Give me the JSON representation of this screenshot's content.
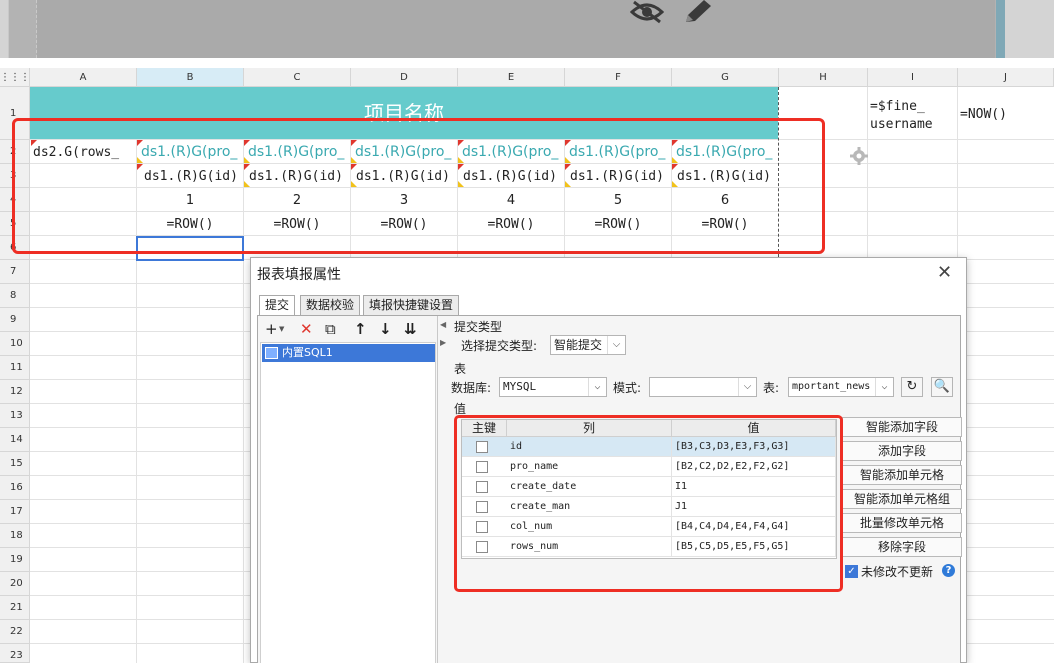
{
  "preview": {
    "icons": [
      "eye-off-icon",
      "pencil-icon"
    ]
  },
  "grid": {
    "corner": "⋮⋮⋮",
    "columns": [
      "A",
      "B",
      "C",
      "D",
      "E",
      "F",
      "G",
      "H",
      "I",
      "J"
    ],
    "selected_column": "B",
    "rows": [
      "1",
      "2",
      "3",
      "4",
      "5",
      "6",
      "7",
      "8",
      "9",
      "10",
      "11",
      "12",
      "13",
      "14",
      "15",
      "16",
      "17",
      "18",
      "19",
      "20",
      "21",
      "22",
      "23"
    ],
    "title_cell": "项目名称",
    "row1": {
      "I": "=$fine_\nusername",
      "J": "=NOW()"
    },
    "row2": {
      "A": "ds2.G(rows_",
      "B": "ds1.(R)G(pro_",
      "C": "ds1.(R)G(pro_",
      "D": "ds1.(R)G(pro_",
      "E": "ds1.(R)G(pro_",
      "F": "ds1.(R)G(pro_",
      "G": "ds1.(R)G(pro_"
    },
    "row3": [
      "ds1.(R)G(id)",
      "ds1.(R)G(id)",
      "ds1.(R)G(id)",
      "ds1.(R)G(id)",
      "ds1.(R)G(id)",
      "ds1.(R)G(id)"
    ],
    "row4": [
      "1",
      "2",
      "3",
      "4",
      "5",
      "6"
    ],
    "row5": [
      "=ROW()",
      "=ROW()",
      "=ROW()",
      "=ROW()",
      "=ROW()",
      "=ROW()"
    ],
    "gear_icon": "gear-icon"
  },
  "dialog": {
    "title": "报表填报属性",
    "close": "✕",
    "tabs": [
      "提交",
      "数据校验",
      "填报快捷键设置"
    ],
    "active_tab": 0,
    "toolbar": [
      "+",
      "✕",
      "⧉",
      "↑",
      "↓",
      "⇊"
    ],
    "sql_item": "内置SQL1",
    "submit_type_section": "提交类型",
    "submit_type_label": "选择提交类型:",
    "submit_type_value": "智能提交",
    "table_section": "表",
    "db_label": "数据库:",
    "db_value": "MYSQL",
    "schema_label": "模式:",
    "schema_value": "",
    "table_label": "表:",
    "table_value": "mportant_news",
    "value_section": "值",
    "table_headers": [
      "主键",
      "列",
      "值"
    ],
    "table_rows": [
      {
        "key": false,
        "column": "id",
        "value": "[B3,C3,D3,E3,F3,G3]"
      },
      {
        "key": false,
        "column": "pro_name",
        "value": "[B2,C2,D2,E2,F2,G2]"
      },
      {
        "key": false,
        "column": "create_date",
        "value": "I1"
      },
      {
        "key": false,
        "column": "create_man",
        "value": "J1"
      },
      {
        "key": false,
        "column": "col_num",
        "value": "[B4,C4,D4,E4,F4,G4]"
      },
      {
        "key": false,
        "column": "rows_num",
        "value": "[B5,C5,D5,E5,F5,G5]"
      }
    ],
    "side_buttons": [
      "智能添加字段",
      "添加字段",
      "智能添加单元格",
      "智能添加单元格组",
      "批量修改单元格",
      "移除字段"
    ],
    "no_change_label": "未修改不更新",
    "no_change_checked": true,
    "help": "?"
  },
  "colors": {
    "title_band": "#66cbcc",
    "formula_teal": "#3aa9b0",
    "highlight_red": "#ee2e24",
    "selection_blue": "#3d78d8"
  }
}
